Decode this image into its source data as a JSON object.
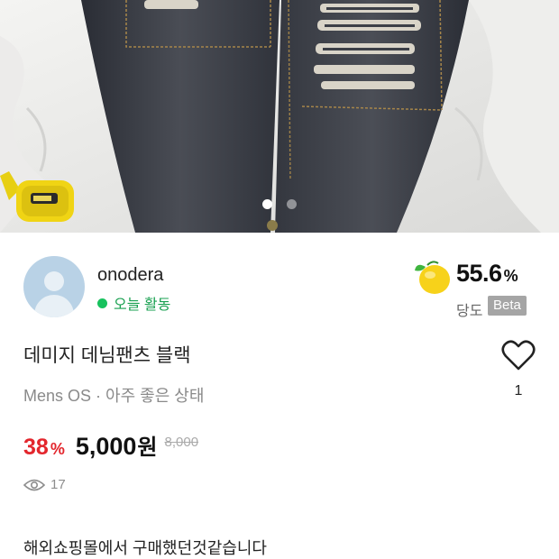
{
  "photo": {
    "description_icon": "photo-carousel",
    "slide_count": 2,
    "active_slide": 1
  },
  "seller": {
    "name": "onodera",
    "activity": "오늘 활동",
    "activity_color": "#18c25e"
  },
  "score": {
    "value": "55.6",
    "unit": "%",
    "label": "당도",
    "badge": "Beta",
    "icon": "lemon-icon"
  },
  "product": {
    "title": "데미지 데님팬츠 블랙",
    "meta": "Mens OS · 아주 좋은 상태",
    "discount": "38",
    "discount_unit": "%",
    "price": "5,000",
    "price_unit": "원",
    "original_price": "8,000",
    "views": "17",
    "likes": "1",
    "description": "해외쇼핑몰에서 구매했던것같습니다"
  },
  "colors": {
    "discount": "#e3262d",
    "accent_green": "#18c25e",
    "badge_bg": "#a5a5a5"
  }
}
